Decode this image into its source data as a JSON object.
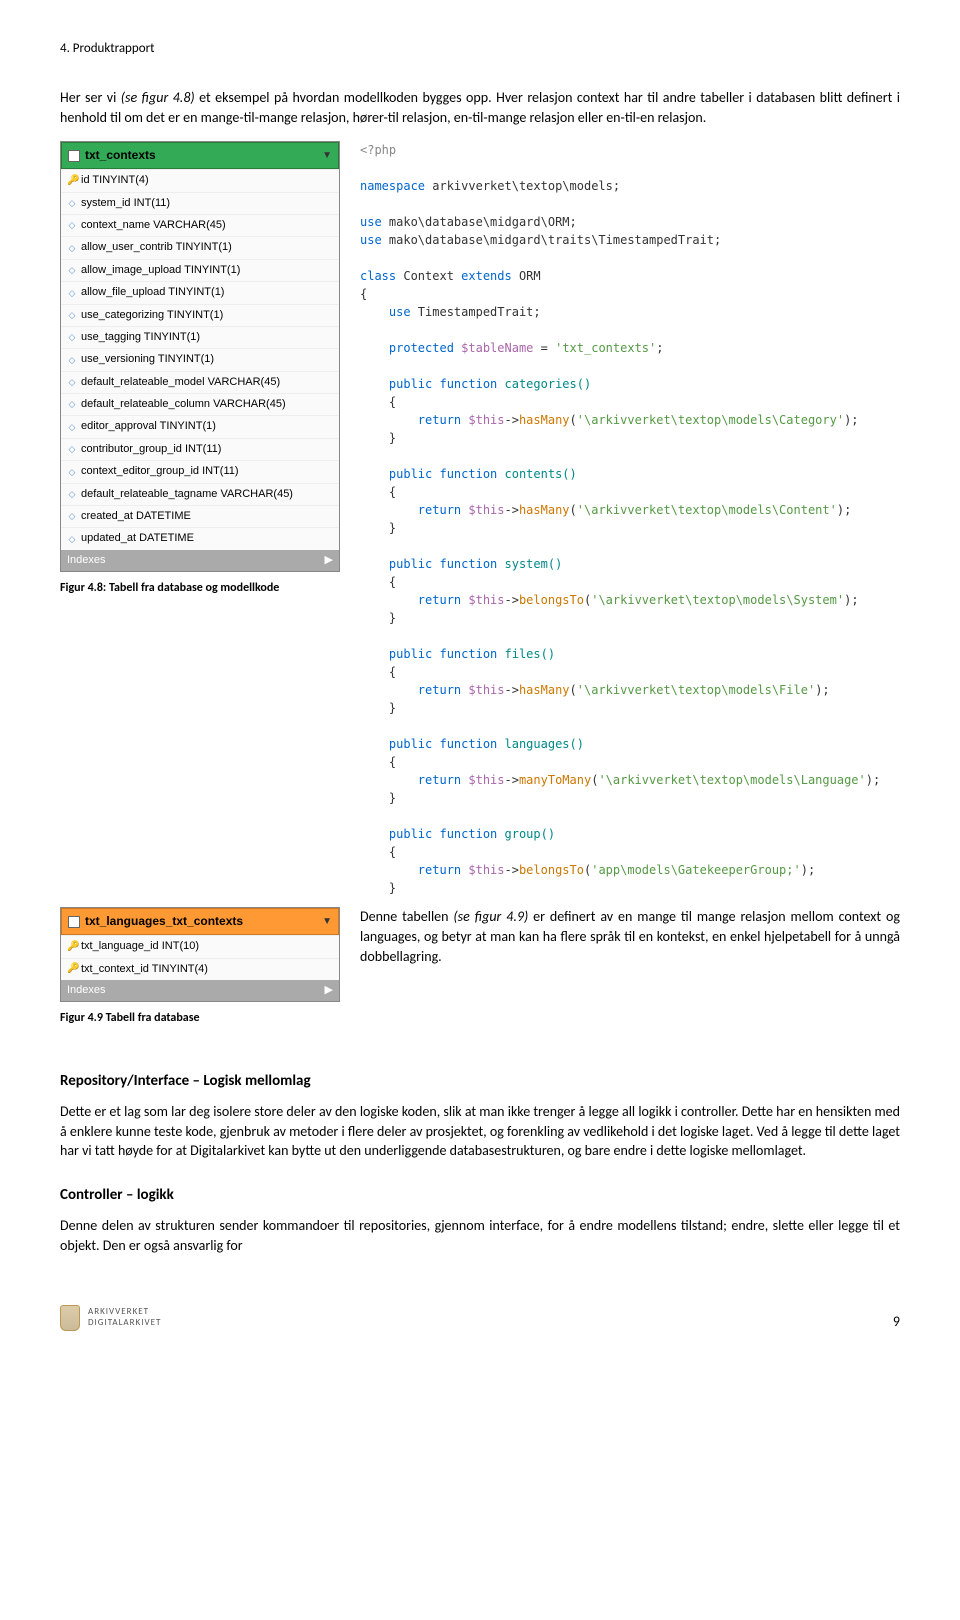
{
  "header": "4. Produktrapport",
  "intro_1a": "Her ser vi ",
  "intro_1b": "(se figur 4.8)",
  "intro_1c": " et eksempel på hvordan modellkoden bygges opp. Hver relasjon context har til andre tabeller i databasen blitt definert i henhold til om det er en mange-til-mange relasjon, hører-til relasjon, en-til-mange relasjon eller en-til-en relasjon.",
  "db1": {
    "name": "txt_contexts",
    "rows": [
      "id TINYINT(4)",
      "system_id INT(11)",
      "context_name VARCHAR(45)",
      "allow_user_contrib TINYINT(1)",
      "allow_image_upload TINYINT(1)",
      "allow_file_upload TINYINT(1)",
      "use_categorizing TINYINT(1)",
      "use_tagging TINYINT(1)",
      "use_versioning TINYINT(1)",
      "default_relateable_model VARCHAR(45)",
      "default_relateable_column VARCHAR(45)",
      "editor_approval TINYINT(1)",
      "contributor_group_id INT(11)",
      "context_editor_group_id INT(11)",
      "default_relateable_tagname VARCHAR(45)",
      "created_at DATETIME",
      "updated_at DATETIME"
    ],
    "indexes": "Indexes"
  },
  "caption1": "Figur 4.8: Tabell fra database og modellkode",
  "code": {
    "l1": "<?php",
    "l2a": "namespace ",
    "l2b": "arkivverket\\textop\\models;",
    "l3a": "use ",
    "l3b": "mako\\database\\midgard\\ORM;",
    "l4a": "use ",
    "l4b": "mako\\database\\midgard\\traits\\TimestampedTrait;",
    "l5a": "class ",
    "l5b": "Context ",
    "l5c": "extends ",
    "l5d": "ORM",
    "l6": "{",
    "l7a": "    use ",
    "l7b": "TimestampedTrait;",
    "l8a": "    protected ",
    "l8b": "$tableName ",
    "l8c": "= ",
    "l8d": "'txt_contexts'",
    "l8e": ";",
    "f1a": "    public function ",
    "f1b": "categories()",
    "f1c": "    {",
    "f1d": "        return ",
    "f1e": "$this",
    "f1f": "->",
    "f1g": "hasMany",
    "f1h": "(",
    "f1i": "'\\arkivverket\\textop\\models\\Category'",
    "f1j": ");",
    "f1k": "    }",
    "f2a": "    public function ",
    "f2b": "contents()",
    "f2d": "        return ",
    "f2e": "$this",
    "f2f": "->",
    "f2g": "hasMany",
    "f2h": "(",
    "f2i": "'\\arkivverket\\textop\\models\\Content'",
    "f2j": ");",
    "f3a": "    public function ",
    "f3b": "system()",
    "f3d": "        return ",
    "f3e": "$this",
    "f3f": "->",
    "f3g": "belongsTo",
    "f3h": "(",
    "f3i": "'\\arkivverket\\textop\\models\\System'",
    "f3j": ");",
    "f4a": "    public function ",
    "f4b": "files()",
    "f4d": "        return ",
    "f4e": "$this",
    "f4f": "->",
    "f4g": "hasMany",
    "f4h": "(",
    "f4i": "'\\arkivverket\\textop\\models\\File'",
    "f4j": ");",
    "f5a": "    public function ",
    "f5b": "languages()",
    "f5d": "        return ",
    "f5e": "$this",
    "f5f": "->",
    "f5g": "manyToMany",
    "f5h": "(",
    "f5i": "'\\arkivverket\\textop\\models\\Language'",
    "f5j": ");",
    "f6a": "    public function ",
    "f6b": "group()",
    "f6d": "        return ",
    "f6e": "$this",
    "f6f": "->",
    "f6g": "belongsTo",
    "f6h": "(",
    "f6i": "'app\\models\\GatekeeperGroup;'",
    "f6j": ");",
    "end": "    }"
  },
  "db2": {
    "name": "txt_languages_txt_contexts",
    "rows": [
      "txt_language_id INT(10)",
      "txt_context_id TINYINT(4)"
    ],
    "indexes": "Indexes"
  },
  "caption2": "Figur 4.9 Tabell fra database",
  "mid_para_a": "Denne tabellen ",
  "mid_para_b": "(se figur 4.9)",
  "mid_para_c": " er definert av en mange til mange relasjon mellom context og languages, og betyr at man kan ha flere språk til en kontekst, en enkel hjelpetabell for å unngå dobbellagring.",
  "h2": "Repository/Interface – Logisk mellomlag",
  "p2": "Dette er et lag som lar deg isolere store deler av den logiske koden, slik at man ikke trenger å legge all logikk i controller. Dette har en hensikten med å enklere kunne teste kode, gjenbruk av metoder i flere deler av prosjektet, og forenkling av vedlikehold i det logiske laget. Ved å legge til dette laget har vi tatt høyde for at Digitalarkivet kan bytte ut den underliggende databasestrukturen, og bare endre i dette logiske mellomlaget.",
  "h3": "Controller – logikk",
  "p3": "Denne delen av strukturen sender kommandoer til repositories, gjennom interface, for å endre modellens tilstand; endre, slette eller legge til et objekt. Den er også ansvarlig for",
  "logo_line1": "ARKIVVERKET",
  "logo_line2": "DIGITALARKIVET",
  "pagenum": "9"
}
